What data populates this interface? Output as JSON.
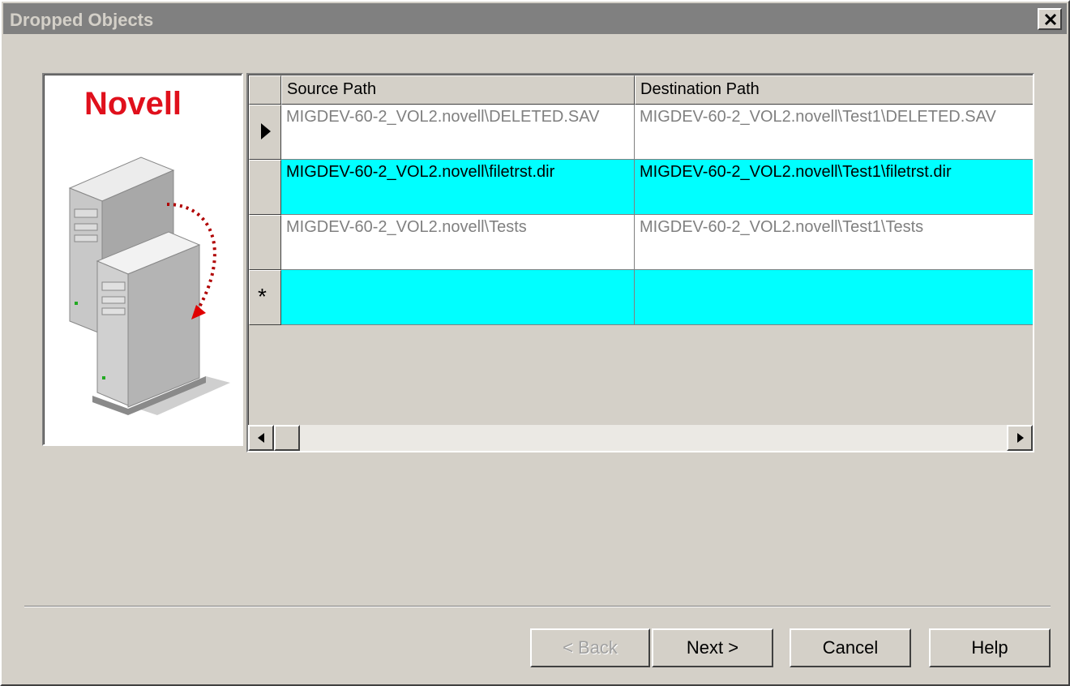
{
  "window": {
    "title": "Dropped Objects"
  },
  "brand": {
    "name": "Novell"
  },
  "grid": {
    "columns": [
      "Source Path",
      "Destination Path"
    ],
    "rows": [
      {
        "source": "MIGDEV-60-2_VOL2.novell\\DELETED.SAV",
        "destination": "MIGDEV-60-2_VOL2.novell\\Test1\\DELETED.SAV",
        "indicator": "current"
      },
      {
        "source": "MIGDEV-60-2_VOL2.novell\\filetrst.dir",
        "destination": "MIGDEV-60-2_VOL2.novell\\Test1\\filetrst.dir",
        "indicator": ""
      },
      {
        "source": "MIGDEV-60-2_VOL2.novell\\Tests",
        "destination": "MIGDEV-60-2_VOL2.novell\\Test1\\Tests",
        "indicator": ""
      }
    ],
    "new_row_marker": "*"
  },
  "buttons": {
    "back": "< Back",
    "next": "Next >",
    "cancel": "Cancel",
    "help": "Help"
  },
  "colors": {
    "highlight": "#00ffff",
    "brand": "#e0101c",
    "title_bar": "#808080"
  }
}
